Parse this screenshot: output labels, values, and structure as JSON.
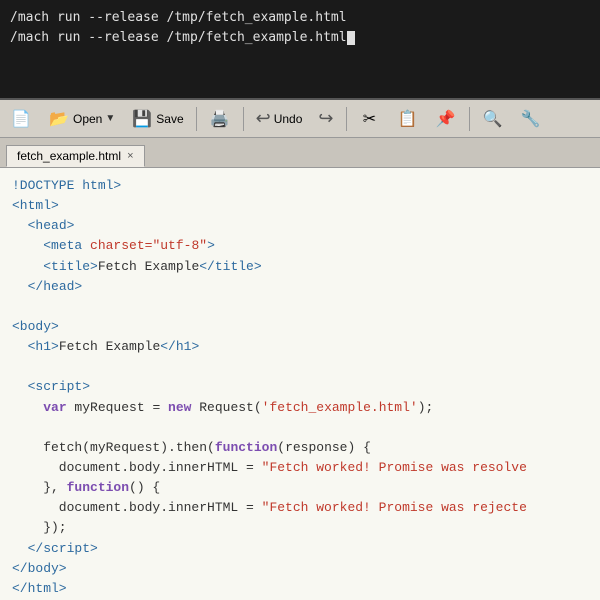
{
  "terminal": {
    "lines": [
      "/mach run --release /tmp/fetch_example.html",
      "/mach run --release /tmp/fetch_example.html"
    ]
  },
  "toolbar": {
    "open_label": "Open",
    "save_label": "Save",
    "undo_label": "Undo"
  },
  "tab": {
    "filename": "fetch_example.html",
    "close_label": "×"
  },
  "editor": {
    "title": "fetch_example.html"
  }
}
